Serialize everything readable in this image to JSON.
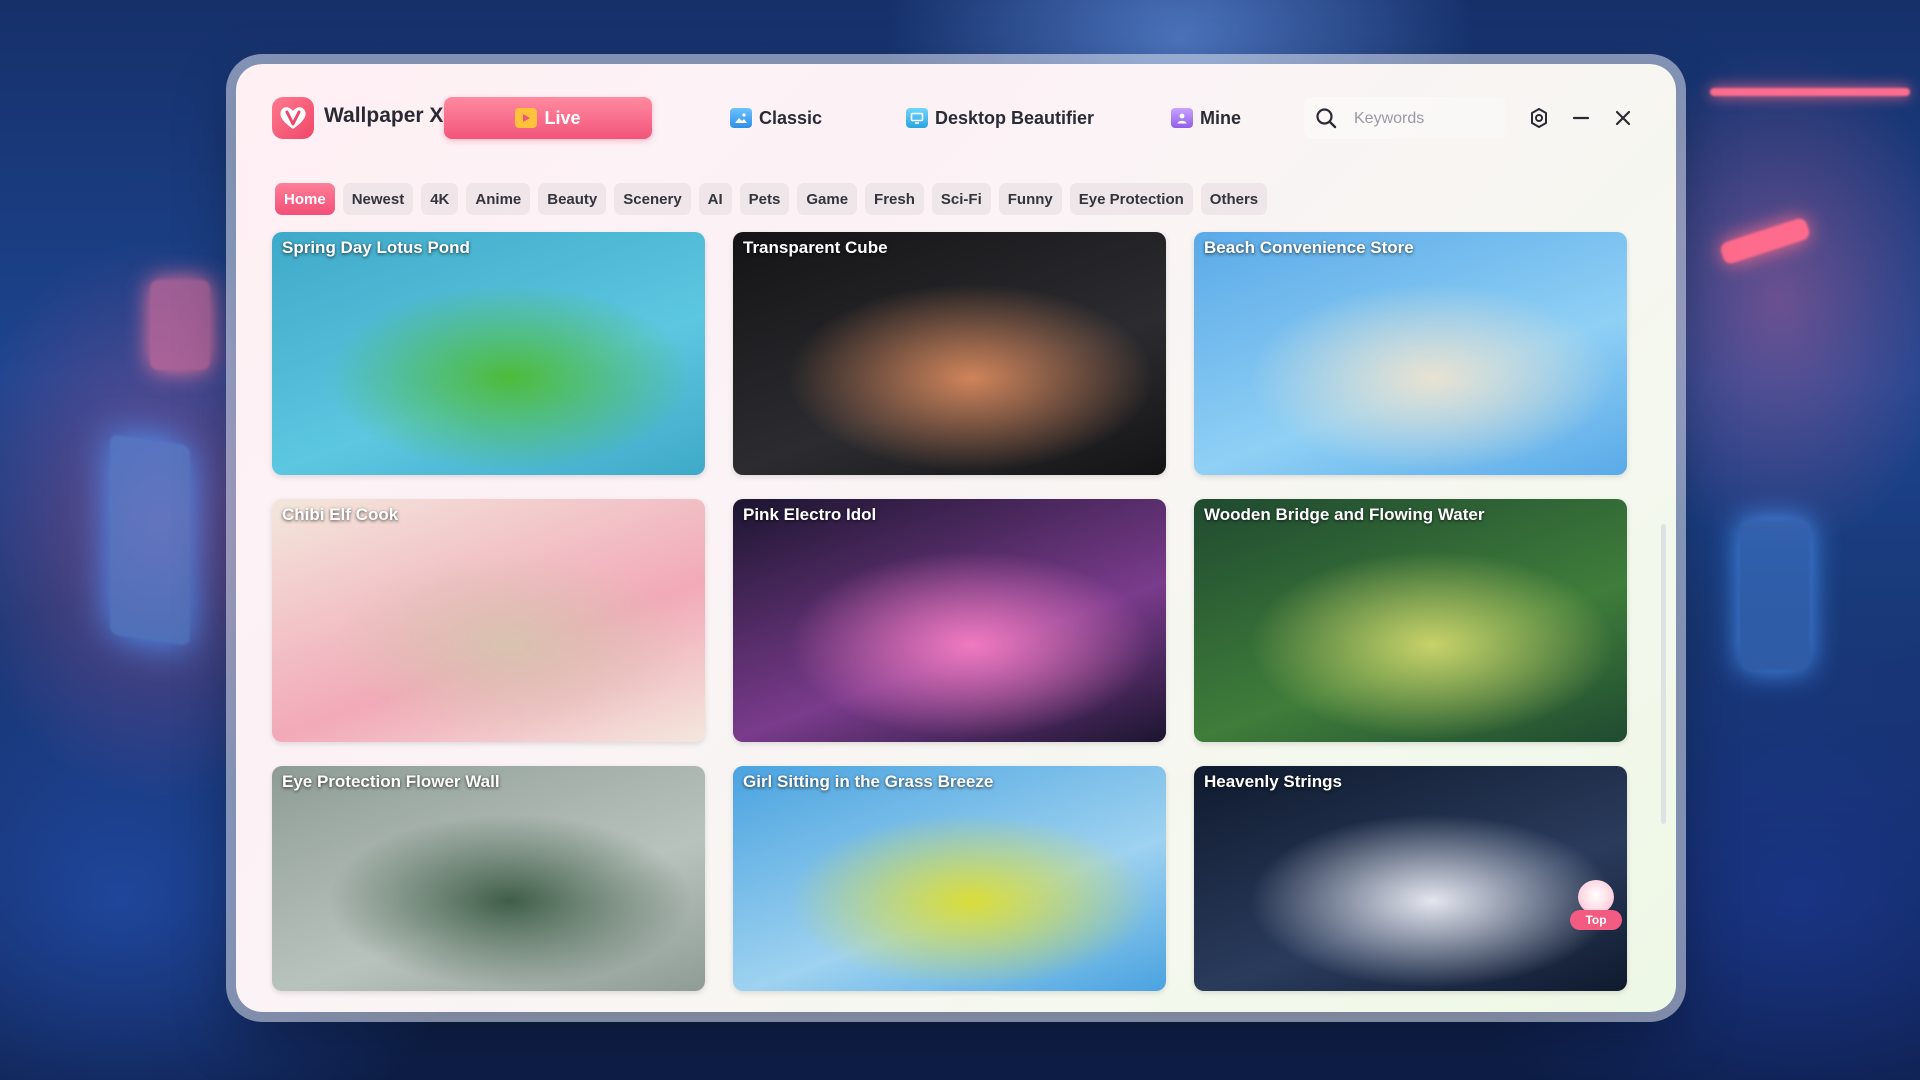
{
  "app": {
    "title": "Wallpaper X",
    "brand_color": "#f2557a"
  },
  "nav": {
    "tabs": [
      {
        "label": "Live",
        "active": true,
        "icon": "play-icon"
      },
      {
        "label": "Classic",
        "active": false,
        "icon": "image-icon"
      },
      {
        "label": "Desktop Beautifier",
        "active": false,
        "icon": "desktop-icon"
      },
      {
        "label": "Mine",
        "active": false,
        "icon": "user-icon"
      }
    ]
  },
  "search": {
    "placeholder": "Keywords",
    "value": ""
  },
  "window_controls": {
    "settings_icon": "settings-icon",
    "minimize_icon": "minimize-icon",
    "close_icon": "close-icon"
  },
  "categories": [
    {
      "label": "Home",
      "active": true
    },
    {
      "label": "Newest",
      "active": false
    },
    {
      "label": "4K",
      "active": false
    },
    {
      "label": "Anime",
      "active": false
    },
    {
      "label": "Beauty",
      "active": false
    },
    {
      "label": "Scenery",
      "active": false
    },
    {
      "label": "AI",
      "active": false
    },
    {
      "label": "Pets",
      "active": false
    },
    {
      "label": "Game",
      "active": false
    },
    {
      "label": "Fresh",
      "active": false
    },
    {
      "label": "Sci-Fi",
      "active": false
    },
    {
      "label": "Funny",
      "active": false
    },
    {
      "label": "Eye Protection",
      "active": false
    },
    {
      "label": "Others",
      "active": false
    }
  ],
  "wallpapers": [
    {
      "title": "Spring Day Lotus Pond",
      "palette": [
        "#3fa9c9",
        "#5cc7e0",
        "#4dbb3a"
      ]
    },
    {
      "title": "Transparent Cube",
      "palette": [
        "#141416",
        "#2c2c30",
        "#d0845a"
      ]
    },
    {
      "title": "Beach Convenience Store",
      "palette": [
        "#5aa9e8",
        "#8fd0f5",
        "#e8e2d2"
      ]
    },
    {
      "title": "Chibi Elf Cook",
      "palette": [
        "#f3e7dd",
        "#f2a9b8",
        "#d8c3b0"
      ]
    },
    {
      "title": "Pink Electro Idol",
      "palette": [
        "#1c1530",
        "#7a3b8c",
        "#f07ac0"
      ]
    },
    {
      "title": "Wooden Bridge and Flowing Water",
      "palette": [
        "#1f4a30",
        "#3f7d3a",
        "#c8d26a"
      ]
    },
    {
      "title": "Eye Protection Flower Wall",
      "palette": [
        "#8f9c96",
        "#b9c3bd",
        "#3f5e48"
      ]
    },
    {
      "title": "Girl Sitting in the Grass Breeze",
      "palette": [
        "#4aa3e0",
        "#9ed2f0",
        "#d9dd3a"
      ]
    },
    {
      "title": "Heavenly Strings",
      "palette": [
        "#0f1a2e",
        "#2a3b5c",
        "#e4e6ee"
      ]
    }
  ],
  "top_badge": {
    "label": "Top"
  }
}
